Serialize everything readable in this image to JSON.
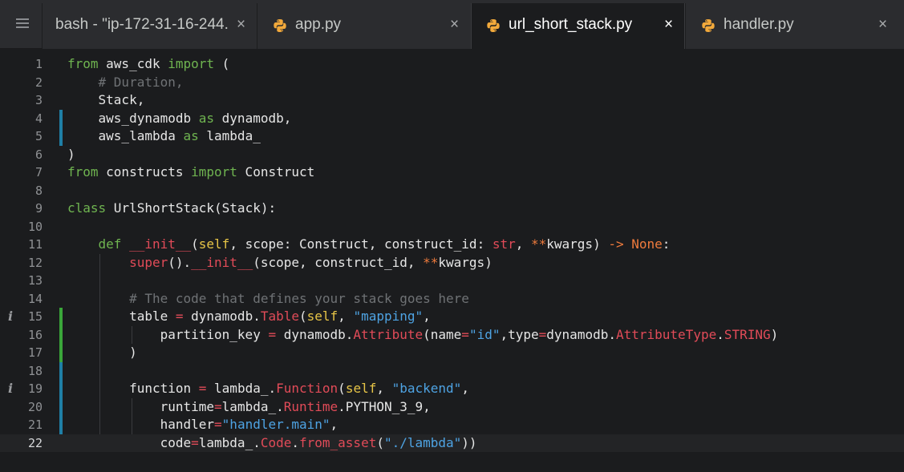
{
  "tabs": [
    {
      "label": "bash - \"ip-172-31-16-244.",
      "close": "×",
      "icon": "none",
      "active": false
    },
    {
      "label": "app.py",
      "close": "×",
      "icon": "python-icon",
      "active": false
    },
    {
      "label": "url_short_stack.py",
      "close": "×",
      "icon": "python-icon",
      "active": true
    },
    {
      "label": "handler.py",
      "close": "×",
      "icon": "python-icon",
      "active": false
    }
  ],
  "editor": {
    "language": "python",
    "current_line": 22,
    "line_numbers": [
      "1",
      "2",
      "3",
      "4",
      "5",
      "6",
      "7",
      "8",
      "9",
      "10",
      "11",
      "12",
      "13",
      "14",
      "15",
      "16",
      "17",
      "18",
      "19",
      "20",
      "21",
      "22"
    ],
    "info_markers": {
      "15": "i",
      "19": "i"
    },
    "lines": [
      "from aws_cdk import (",
      "    # Duration,",
      "    Stack,",
      "    aws_dynamodb as dynamodb,",
      "    aws_lambda as lambda_",
      ")",
      "from constructs import Construct",
      "",
      "class UrlShortStack(Stack):",
      "",
      "    def __init__(self, scope: Construct, construct_id: str, **kwargs) -> None:",
      "        super().__init__(scope, construct_id, **kwargs)",
      "",
      "        # The code that defines your stack goes here",
      "        table = dynamodb.Table(self, \"mapping\",",
      "            partition_key = dynamodb.Attribute(name=\"id\",type=dynamodb.AttributeType.STRING)",
      "        )",
      "",
      "        function = lambda_.Function(self, \"backend\",",
      "            runtime=lambda_.Runtime.PYTHON_3_9,",
      "            handler=\"handler.main\",",
      "            code=lambda_.Code.from_asset(\"./lambda\"))"
    ],
    "colors": {
      "keyword": "#6fb450",
      "comment": "#6f7275",
      "string": "#4ea3e3",
      "self": "#e7c547",
      "call": "#e14b58",
      "none_const": "#ef7b3d",
      "gutter_modified": "#1f7fa6",
      "gutter_added": "#3aa63a"
    }
  }
}
